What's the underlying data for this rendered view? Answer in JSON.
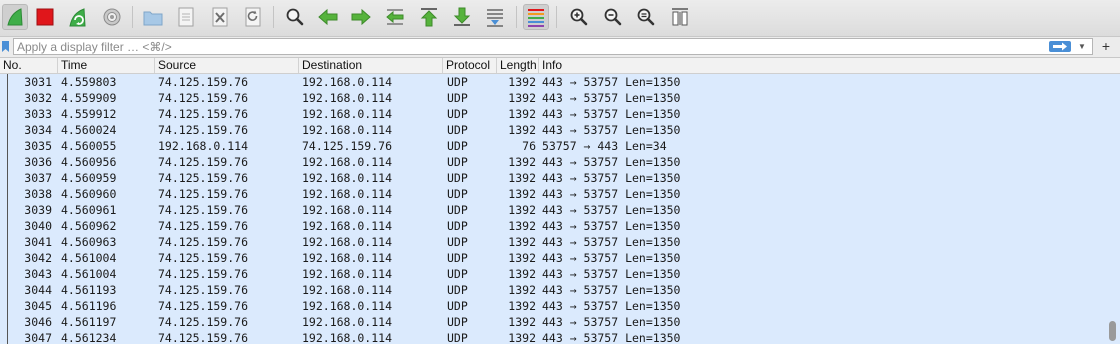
{
  "toolbar": {
    "buttons": [
      {
        "name": "start-capture-icon"
      },
      {
        "name": "stop-capture-icon"
      },
      {
        "name": "restart-capture-icon"
      },
      {
        "name": "capture-options-icon"
      },
      {
        "name": "open-file-icon"
      },
      {
        "name": "save-file-icon"
      },
      {
        "name": "close-file-icon"
      },
      {
        "name": "reload-file-icon"
      },
      {
        "name": "find-packet-icon"
      },
      {
        "name": "go-back-icon"
      },
      {
        "name": "go-forward-icon"
      },
      {
        "name": "go-to-packet-icon"
      },
      {
        "name": "go-first-packet-icon"
      },
      {
        "name": "go-last-packet-icon"
      },
      {
        "name": "auto-scroll-icon"
      },
      {
        "name": "colorize-icon"
      },
      {
        "name": "zoom-in-icon"
      },
      {
        "name": "zoom-out-icon"
      },
      {
        "name": "normal-size-icon"
      },
      {
        "name": "resize-columns-icon"
      }
    ]
  },
  "filter": {
    "placeholder": "Apply a display filter … <⌘/>",
    "value": "",
    "add_label": "+"
  },
  "columns": {
    "no": "No.",
    "time": "Time",
    "source": "Source",
    "destination": "Destination",
    "protocol": "Protocol",
    "length": "Length",
    "info": "Info"
  },
  "packets": [
    {
      "no": "3031",
      "time": "4.559803",
      "source": "74.125.159.76",
      "destination": "192.168.0.114",
      "protocol": "UDP",
      "length": "1392",
      "info": "443 → 53757 Len=1350"
    },
    {
      "no": "3032",
      "time": "4.559909",
      "source": "74.125.159.76",
      "destination": "192.168.0.114",
      "protocol": "UDP",
      "length": "1392",
      "info": "443 → 53757 Len=1350"
    },
    {
      "no": "3033",
      "time": "4.559912",
      "source": "74.125.159.76",
      "destination": "192.168.0.114",
      "protocol": "UDP",
      "length": "1392",
      "info": "443 → 53757 Len=1350"
    },
    {
      "no": "3034",
      "time": "4.560024",
      "source": "74.125.159.76",
      "destination": "192.168.0.114",
      "protocol": "UDP",
      "length": "1392",
      "info": "443 → 53757 Len=1350"
    },
    {
      "no": "3035",
      "time": "4.560055",
      "source": "192.168.0.114",
      "destination": "74.125.159.76",
      "protocol": "UDP",
      "length": "76",
      "info": "53757 → 443 Len=34"
    },
    {
      "no": "3036",
      "time": "4.560956",
      "source": "74.125.159.76",
      "destination": "192.168.0.114",
      "protocol": "UDP",
      "length": "1392",
      "info": "443 → 53757 Len=1350"
    },
    {
      "no": "3037",
      "time": "4.560959",
      "source": "74.125.159.76",
      "destination": "192.168.0.114",
      "protocol": "UDP",
      "length": "1392",
      "info": "443 → 53757 Len=1350"
    },
    {
      "no": "3038",
      "time": "4.560960",
      "source": "74.125.159.76",
      "destination": "192.168.0.114",
      "protocol": "UDP",
      "length": "1392",
      "info": "443 → 53757 Len=1350"
    },
    {
      "no": "3039",
      "time": "4.560961",
      "source": "74.125.159.76",
      "destination": "192.168.0.114",
      "protocol": "UDP",
      "length": "1392",
      "info": "443 → 53757 Len=1350"
    },
    {
      "no": "3040",
      "time": "4.560962",
      "source": "74.125.159.76",
      "destination": "192.168.0.114",
      "protocol": "UDP",
      "length": "1392",
      "info": "443 → 53757 Len=1350"
    },
    {
      "no": "3041",
      "time": "4.560963",
      "source": "74.125.159.76",
      "destination": "192.168.0.114",
      "protocol": "UDP",
      "length": "1392",
      "info": "443 → 53757 Len=1350"
    },
    {
      "no": "3042",
      "time": "4.561004",
      "source": "74.125.159.76",
      "destination": "192.168.0.114",
      "protocol": "UDP",
      "length": "1392",
      "info": "443 → 53757 Len=1350"
    },
    {
      "no": "3043",
      "time": "4.561004",
      "source": "74.125.159.76",
      "destination": "192.168.0.114",
      "protocol": "UDP",
      "length": "1392",
      "info": "443 → 53757 Len=1350"
    },
    {
      "no": "3044",
      "time": "4.561193",
      "source": "74.125.159.76",
      "destination": "192.168.0.114",
      "protocol": "UDP",
      "length": "1392",
      "info": "443 → 53757 Len=1350"
    },
    {
      "no": "3045",
      "time": "4.561196",
      "source": "74.125.159.76",
      "destination": "192.168.0.114",
      "protocol": "UDP",
      "length": "1392",
      "info": "443 → 53757 Len=1350"
    },
    {
      "no": "3046",
      "time": "4.561197",
      "source": "74.125.159.76",
      "destination": "192.168.0.114",
      "protocol": "UDP",
      "length": "1392",
      "info": "443 → 53757 Len=1350"
    },
    {
      "no": "3047",
      "time": "4.561234",
      "source": "74.125.159.76",
      "destination": "192.168.0.114",
      "protocol": "UDP",
      "length": "1392",
      "info": "443 → 53757 Len=1350"
    }
  ],
  "colors": {
    "row_background": "#dbeafd",
    "accent": "#4a8fd6",
    "stop_red": "#e0161b",
    "shark_green": "#3fae49"
  }
}
